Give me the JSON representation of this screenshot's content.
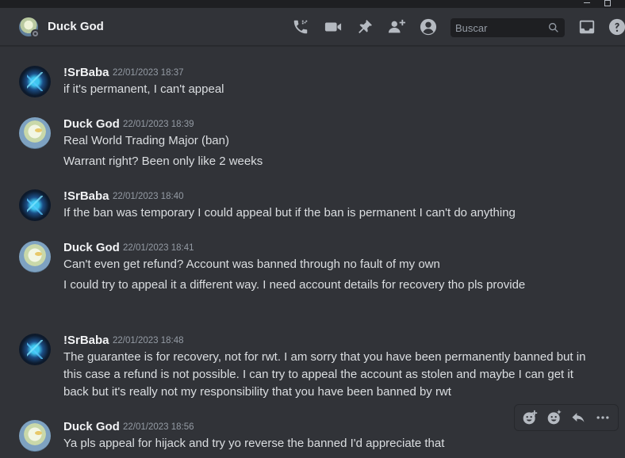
{
  "header": {
    "title": "Duck God",
    "search_placeholder": "Buscar"
  },
  "icons": {
    "phone": "phone-call-icon",
    "video": "video-camera-icon",
    "pin": "pin-icon",
    "add_friend": "add-user-icon",
    "profile": "user-profile-icon",
    "search": "search-icon",
    "inbox": "inbox-icon",
    "help": "help-icon"
  },
  "colors": {
    "background": "#313338",
    "header_border": "#26282c",
    "username": "#f2f3f5",
    "text": "#dbdee1",
    "muted": "#949ba4",
    "icon": "#b5bac1"
  },
  "messages": [
    {
      "author": "!SrBaba",
      "timestamp": "22/01/2023 18:37",
      "lines": [
        "if it's permanent, I can't appeal"
      ]
    },
    {
      "author": "Duck God",
      "timestamp": "22/01/2023 18:39",
      "lines": [
        "Real World Trading Major (ban)",
        "Warrant right? Been only like 2 weeks"
      ]
    },
    {
      "author": "!SrBaba",
      "timestamp": "22/01/2023 18:40",
      "lines": [
        "If the ban was temporary I could appeal but if the ban is permanent I can't do anything"
      ]
    },
    {
      "author": "Duck God",
      "timestamp": "22/01/2023 18:41",
      "lines": [
        "Can't even get refund? Account was banned through no fault of my own",
        "I could try to appeal it a different way. I need account details for recovery tho pls provide"
      ]
    },
    {
      "author": "!SrBaba",
      "timestamp": "22/01/2023 18:48",
      "lines": [
        "The guarantee is for recovery, not for rwt. I am sorry that you have been permanently banned but in this case a refund is not possible. I can try to appeal the account as stolen and maybe I can get it back but it's really not my responsibility that you have been banned by rwt"
      ]
    },
    {
      "author": "Duck God",
      "timestamp": "22/01/2023 18:56",
      "lines": [
        "Ya pls appeal for hijack and try yo reverse the banned I'd appreciate that"
      ]
    }
  ],
  "hover_toolbar": {
    "icons": [
      "add-reaction-icon",
      "super-reaction-icon",
      "reply-icon",
      "more-options-icon"
    ]
  }
}
